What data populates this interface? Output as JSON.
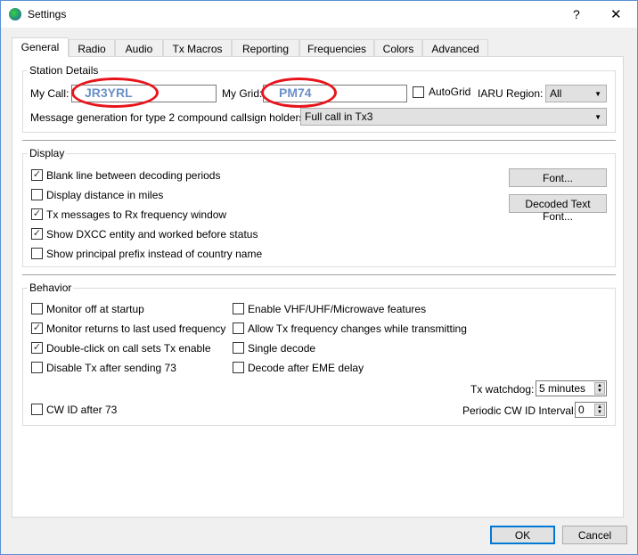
{
  "window": {
    "title": "Settings",
    "help": "?",
    "close": "✕"
  },
  "tabs": [
    "General",
    "Radio",
    "Audio",
    "Tx Macros",
    "Reporting",
    "Frequencies",
    "Colors",
    "Advanced"
  ],
  "station": {
    "title": "Station Details",
    "my_call_label": "My Call:",
    "my_call": "JR3YRL",
    "my_grid_label": "My Grid:",
    "my_grid": "PM74",
    "autogrid": "AutoGrid",
    "autogrid_checked": false,
    "iaru_label": "IARU Region:",
    "iaru_value": "All",
    "msg_label": "Message generation for type 2 compound callsign holders:",
    "msg_value": "Full call in Tx3"
  },
  "display": {
    "title": "Display",
    "items": [
      {
        "label": "Blank line between decoding periods",
        "checked": true
      },
      {
        "label": "Display distance in miles",
        "checked": false
      },
      {
        "label": "Tx messages to Rx frequency window",
        "checked": true
      },
      {
        "label": "Show DXCC entity and worked before status",
        "checked": true
      },
      {
        "label": "Show principal prefix instead of country name",
        "checked": false
      }
    ],
    "font_button": "Font...",
    "decoded_font_button": "Decoded Text Font..."
  },
  "behavior": {
    "title": "Behavior",
    "left": [
      {
        "label": "Monitor off at startup",
        "checked": false
      },
      {
        "label": "Monitor returns to last used frequency",
        "checked": true
      },
      {
        "label": "Double-click on call sets Tx enable",
        "checked": true
      },
      {
        "label": "Disable Tx after sending 73",
        "checked": false
      }
    ],
    "right": [
      {
        "label": "Enable VHF/UHF/Microwave features",
        "checked": false
      },
      {
        "label": "Allow Tx frequency changes while transmitting",
        "checked": false
      },
      {
        "label": "Single decode",
        "checked": false
      },
      {
        "label": "Decode after EME delay",
        "checked": false
      }
    ],
    "watchdog_label": "Tx watchdog:",
    "watchdog_value": "5 minutes",
    "cwid": {
      "label": "CW ID after 73",
      "checked": false
    },
    "cwid_interval_label": "Periodic CW ID Interval:",
    "cwid_interval_value": "0"
  },
  "buttons": {
    "ok": "OK",
    "cancel": "Cancel"
  },
  "colors": {
    "annotation": "#e8141c",
    "accent": "#0078d7"
  }
}
